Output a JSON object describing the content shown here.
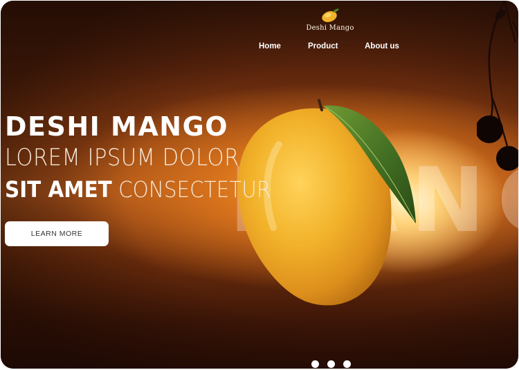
{
  "brand": {
    "name": "Deshi Mango",
    "logo_icon": "mango-logo-icon"
  },
  "nav": {
    "items": [
      "Home",
      "Product",
      "About us"
    ]
  },
  "hero": {
    "title": "DESHI MANGO",
    "line2": "LOREM IPSUM DOLOR",
    "line3_bold": "SIT AMET",
    "line3_light": "CONSECTETUR",
    "button_label": "LEARN MORE",
    "background_word": "MANGO"
  },
  "carousel": {
    "slides": 3,
    "active": 1
  },
  "colors": {
    "accent": "#ffffff",
    "background_dark": "#2a0e05",
    "sun_glow": "#ffd37a",
    "mango": "#f2b22a",
    "leaf": "#3f6b22"
  }
}
